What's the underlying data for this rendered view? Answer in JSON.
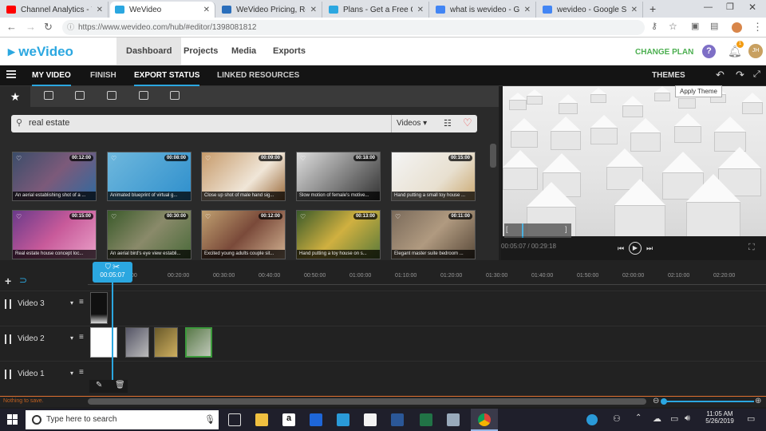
{
  "browser": {
    "tabs": [
      {
        "label": "Channel Analytics - You",
        "color": "#ff0000"
      },
      {
        "label": "WeVideo",
        "color": "#2ba7e0",
        "active": true
      },
      {
        "label": "WeVideo Pricing, Revie",
        "color": "#2a6ebb"
      },
      {
        "label": "Plans - Get a Free Onli",
        "color": "#2ba7e0"
      },
      {
        "label": "what is wevideo - Goog",
        "color": "#4285f4"
      },
      {
        "label": "wevideo - Google Sear",
        "color": "#4285f4"
      }
    ],
    "new_tab": "+",
    "url": "https://www.wevideo.com/hub/#editor/1398081812",
    "back_icon": "back-arrow-icon",
    "forward_icon": "forward-arrow-icon",
    "reload_icon": "reload-icon"
  },
  "app": {
    "logo": "weVideo",
    "nav": [
      "Dashboard",
      "Projects",
      "Media",
      "Exports"
    ],
    "change_plan": "CHANGE PLAN",
    "help": "?",
    "notif_count": "1",
    "avatar": "JH",
    "accent": "#2ba7e0"
  },
  "editor_tabs": [
    "MY VIDEO",
    "FINISH",
    "EXPORT STATUS",
    "LINKED RESOURCES"
  ],
  "themes": "THEMES",
  "tooltip": "Apply Theme",
  "search": {
    "query": "real estate",
    "filter": "Videos"
  },
  "thumbs": [
    {
      "dur": "00:12:00",
      "cap": "An aerial establishing shot of a ...",
      "bg": "linear-gradient(135deg,#3b4d6a,#7c5a7a 50%,#2f6aa0)"
    },
    {
      "dur": "00:08:00",
      "cap": "Animated blueprint of virtual g...",
      "bg": "linear-gradient(135deg,#6fb8dd,#2e8fcc)"
    },
    {
      "dur": "00:09:00",
      "cap": "Close up shot of male hand sig...",
      "bg": "linear-gradient(135deg,#c69a6a,#f0e6d8 60%,#9a6a3a)"
    },
    {
      "dur": "00:18:00",
      "cap": "Slow motion of female's motive...",
      "bg": "linear-gradient(135deg,#ddd,#888 50%,#333)"
    },
    {
      "dur": "00:15:00",
      "cap": "Hand putting a small toy house ...",
      "bg": "linear-gradient(135deg,#f4f4f4,#e8e0d0 60%,#caa870)"
    },
    {
      "dur": "00:15:00",
      "cap": "Real estate house concept loc...",
      "bg": "linear-gradient(135deg,#6a3a8a,#c85a9a 50%,#e9a0c8)"
    },
    {
      "dur": "00:30:00",
      "cap": "An aerial bird's eye view establi...",
      "bg": "linear-gradient(135deg,#3a5a2a,#8a8a6a 50%,#4a6a3a)"
    },
    {
      "dur": "00:12:00",
      "cap": "Excited young adults couple sit...",
      "bg": "linear-gradient(135deg,#c0a070,#7a4a3a 50%,#d0b090)"
    },
    {
      "dur": "00:13:00",
      "cap": "Hand putting a toy house on s...",
      "bg": "linear-gradient(135deg,#3a5a2a,#d0b040 50%,#5a7a3a)"
    },
    {
      "dur": "00:11:00",
      "cap": "Elegant master suite bedroom ...",
      "bg": "linear-gradient(135deg,#7a6a5a,#b09a80 50%,#5a4a3a)"
    }
  ],
  "preview": {
    "current": "00:05:07",
    "total": "00:29:18",
    "left_bracket": "[",
    "right_bracket": "]"
  },
  "timeline": {
    "playhead_time": "00:05:07",
    "ticks": [
      ":00",
      "00:20:00",
      "00:30:00",
      "00:40:00",
      "00:50:00",
      "01:00:00",
      "01:10:00",
      "01:20:00",
      "01:30:00",
      "01:40:00",
      "01:50:00",
      "02:00:00",
      "02:10:00",
      "02:20:00"
    ],
    "tracks": [
      "Video 3",
      "Video 2",
      "Video 1"
    ],
    "status": "Nothing to save."
  },
  "taskbar": {
    "search_placeholder": "Type here to search",
    "time": "11:05 AM",
    "date": "5/26/2019"
  }
}
